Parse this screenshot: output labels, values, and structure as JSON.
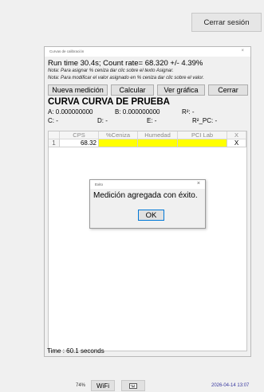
{
  "logout_button": "Cerrar sesión",
  "window": {
    "title": "Curvas de calibración",
    "close_glyph": "×",
    "run_line": "Run time 30.4s; Count rate= 68.320 +/- 4.39%",
    "note1": "Nota: Para asignar % ceniza dar clic sobre el texto Asignar.",
    "note2": "Nota: Para modificar el valor asignado en % ceniza dar clic sobre el valor.",
    "buttons": [
      "Nueva medición",
      "Calcular",
      "Ver gráfica",
      "Cerrar"
    ],
    "curve_header": "CURVA CURVA DE PRUEBA",
    "a_label": "A: 0.000000000",
    "b_label": "B: 0.000000000",
    "r2_label": "R²: -",
    "c_label": "C: -",
    "d_label": "D: -",
    "e_label": "E: -",
    "r2pc_label": "R²_PC: -",
    "table": {
      "columns": [
        "",
        "CPS",
        "%Ceniza",
        "Humedad",
        "PCI Lab",
        "X"
      ],
      "rows": [
        {
          "index": "1",
          "cps": "68.32",
          "ceniza": "",
          "humedad": "",
          "pci": "",
          "x": "X"
        }
      ]
    },
    "time_label": "Time : 60.1 seconds"
  },
  "dialog": {
    "title": "Exito",
    "close_glyph": "×",
    "message": "Medición agregada con éxito.",
    "ok_label": "OK"
  },
  "taskbar": {
    "battery": "74%",
    "wifi": "WiFi",
    "keyboard_icon": "keyboard-icon",
    "datetime": "2026-04-14 13:07"
  }
}
